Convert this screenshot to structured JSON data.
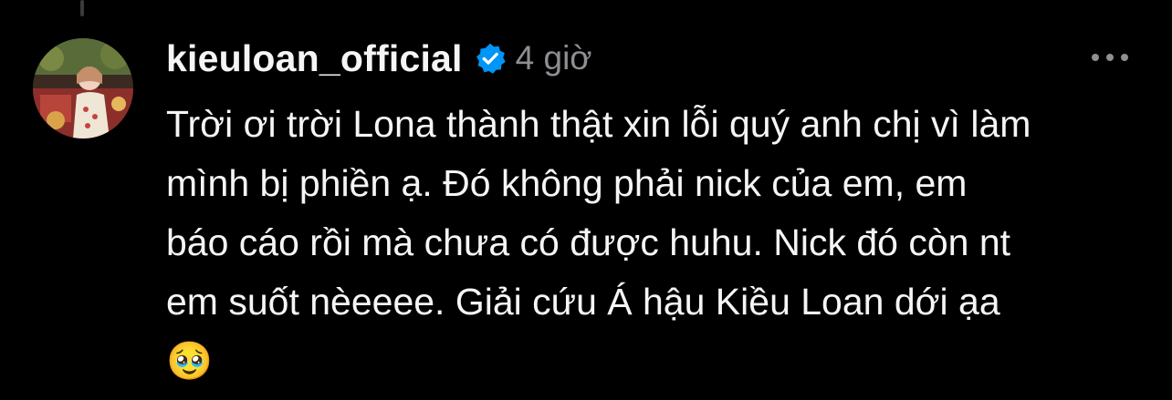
{
  "comment": {
    "username": "kieuloan_official",
    "verified": true,
    "timestamp": "4 giờ",
    "text": "Trời ơi trời Lona thành thật xin lỗi quý anh chị vì làm\nmình bị phiền ạ. Đó không phải nick của em, em\nbáo cáo rồi mà chưa có được huhu. Nick đó còn nt\nem suốt nèeeee. Giải cứu Á hậu Kiều Loan dới ạa\n🥹"
  },
  "icons": {
    "verified": "verified-badge-icon",
    "more": "more-options-icon"
  },
  "colors": {
    "background": "#000000",
    "text": "#f5f5f5",
    "secondary_text": "#8e8e93",
    "verified_blue": "#0095f6"
  }
}
